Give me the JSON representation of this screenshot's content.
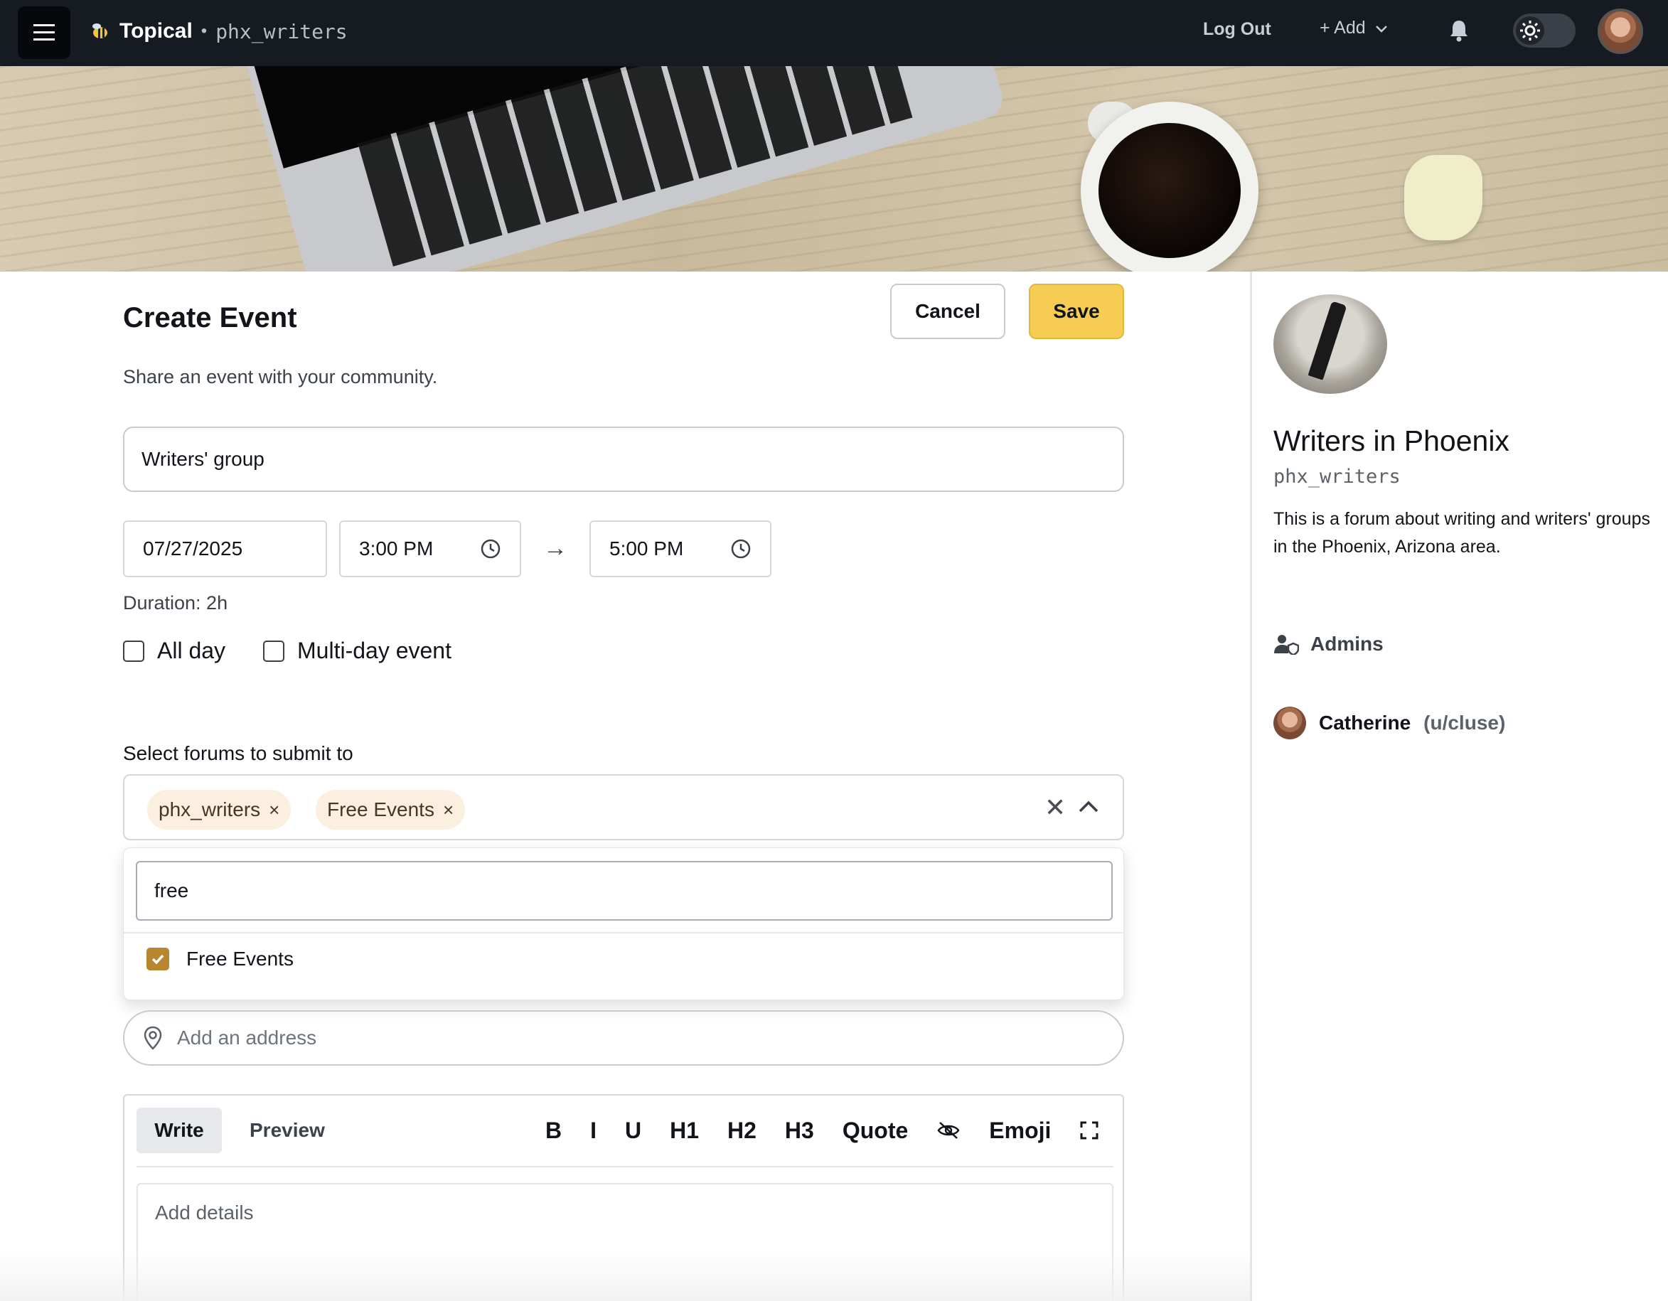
{
  "topbar": {
    "brand_name": "Topical",
    "brand_separator": "•",
    "forum_slug": "phx_writers",
    "logout_label": "Log Out",
    "add_label": "+ Add",
    "icons": [
      "menu-icon",
      "bee-logo-icon",
      "chevron-down-icon",
      "bell-icon",
      "sun-icon"
    ]
  },
  "form": {
    "title": "Create Event",
    "cancel_label": "Cancel",
    "save_label": "Save",
    "subtitle": "Share an event with your community.",
    "event_title_value": "Writers' group",
    "date_value": "07/27/2025",
    "start_time_value": "3:00 PM",
    "end_time_value": "5:00 PM",
    "arrow": "→",
    "duration": "Duration: 2h",
    "all_day_label": "All day",
    "all_day_checked": false,
    "multi_day_label": "Multi-day event",
    "multi_day_checked": false,
    "forums_label": "Select forums to submit to",
    "selected_forums": [
      "phx_writers",
      "Free Events"
    ],
    "chip_remove": "×",
    "clear_all": "✕",
    "dropdown": {
      "search_value": "free",
      "options": [
        {
          "label": "Free Events",
          "checked": true
        }
      ]
    },
    "address_placeholder": "Add an address",
    "editor": {
      "tab_write": "Write",
      "tab_preview": "Preview",
      "tools": [
        "B",
        "I",
        "U",
        "H1",
        "H2",
        "H3",
        "Quote",
        "Emoji"
      ],
      "details_placeholder": "Add details"
    }
  },
  "sidebar": {
    "forum_name": "Writers in Phoenix",
    "forum_slug": "phx_writers",
    "description": "This is a forum about writing and writers' groups in the Phoenix, Arizona area.",
    "admins_label": "Admins",
    "admin_name": "Catherine",
    "admin_handle": "(u/cluse)"
  },
  "colors": {
    "topbar": "#161a21",
    "save_button": "#f6cd52",
    "chip_bg": "#fbefe0",
    "checkbox_checked": "#b8862e"
  }
}
